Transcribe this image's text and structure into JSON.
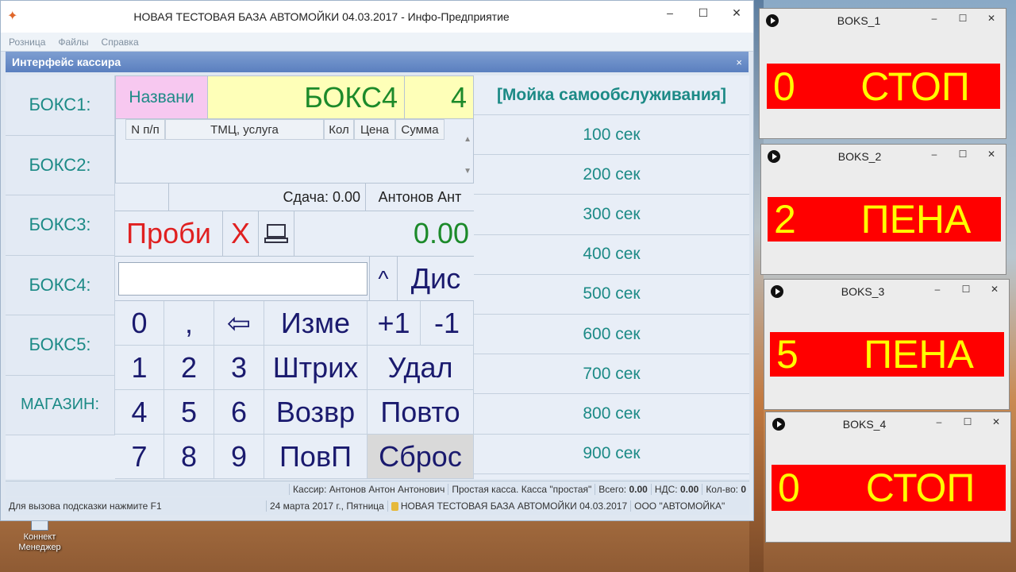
{
  "window": {
    "title": "НОВАЯ ТЕСТОВАЯ БАЗА АВТОМОЙКИ 04.03.2017 - Инфо-Предприятие",
    "minimize": "–",
    "maximize": "☐",
    "close": "✕"
  },
  "menu": [
    "Розница",
    "Файлы",
    "Справка"
  ],
  "panel": {
    "title": "Интерфейс кассира",
    "close": "×"
  },
  "boxes": [
    "БОКС1:",
    "БОКС2:",
    "БОКС3:",
    "БОКС4:",
    "БОКС5:",
    "МАГАЗИН:"
  ],
  "order": {
    "name_label": "Названи",
    "box_name": "БОКС4",
    "box_number": "4",
    "columns": [
      "N п/п",
      "ТМЦ, услуга",
      "Кол",
      "Цена",
      "Сумма"
    ],
    "change": "Сдача: 0.00",
    "operator": "Антонов Ант"
  },
  "actions": {
    "print": "Проби",
    "cancel": "X",
    "total": "0.00"
  },
  "input": {
    "caret": "^",
    "discount": "Дис"
  },
  "keypad": {
    "k0": "0",
    "comma": ",",
    "backspace": "⇦",
    "edit": "Изме",
    "plus1": "+1",
    "minus1": "-1",
    "k1": "1",
    "k2": "2",
    "k3": "3",
    "barcode": "Штрих",
    "delete": "Удал",
    "k4": "4",
    "k5": "5",
    "k6": "6",
    "return": "Возвр",
    "repeat": "Повто",
    "k7": "7",
    "k8": "8",
    "k9": "9",
    "repeat_p": "ПовП",
    "reset": "Сброс"
  },
  "services": {
    "title": "[Мойка самообслуживания]",
    "items": [
      "100 сек",
      "200 сек",
      "300 сек",
      "400 сек",
      "500 сек",
      "600 сек",
      "700 сек",
      "800 сек",
      "900 сек"
    ]
  },
  "status1": {
    "cashier": "Кассир: Антонов Антон Антонович",
    "register": "Простая касса. Касса \"простая\"",
    "total_label": "Всего:",
    "total": "0.00",
    "vat_label": "НДС:",
    "vat": "0.00",
    "qty_label": "Кол-во:",
    "qty": "0"
  },
  "status2": {
    "hint": "Для вызова подсказки нажмите F1",
    "date": "24 марта 2017 г., Пятница",
    "db": "НОВАЯ ТЕСТОВАЯ БАЗА АВТОМОЙКИ 04.03.2017",
    "org": "ООО \"АВТОМОЙКА\""
  },
  "desktop": {
    "icon_label": "Коннект Менеджер"
  },
  "monitors": [
    {
      "title": "BOKS_1",
      "number": "0",
      "state": "СТОП"
    },
    {
      "title": "BOKS_2",
      "number": "2",
      "state": "ПЕНА"
    },
    {
      "title": "BOKS_3",
      "number": "5",
      "state": "ПЕНА"
    },
    {
      "title": "BOKS_4",
      "number": "0",
      "state": "СТОП"
    }
  ],
  "colors": {
    "accent_teal": "#1c8a86",
    "total_green": "#1c8a2a",
    "alert_red": "#e02020",
    "panel_red": "#ff0000",
    "panel_yellow": "#ffff00"
  }
}
